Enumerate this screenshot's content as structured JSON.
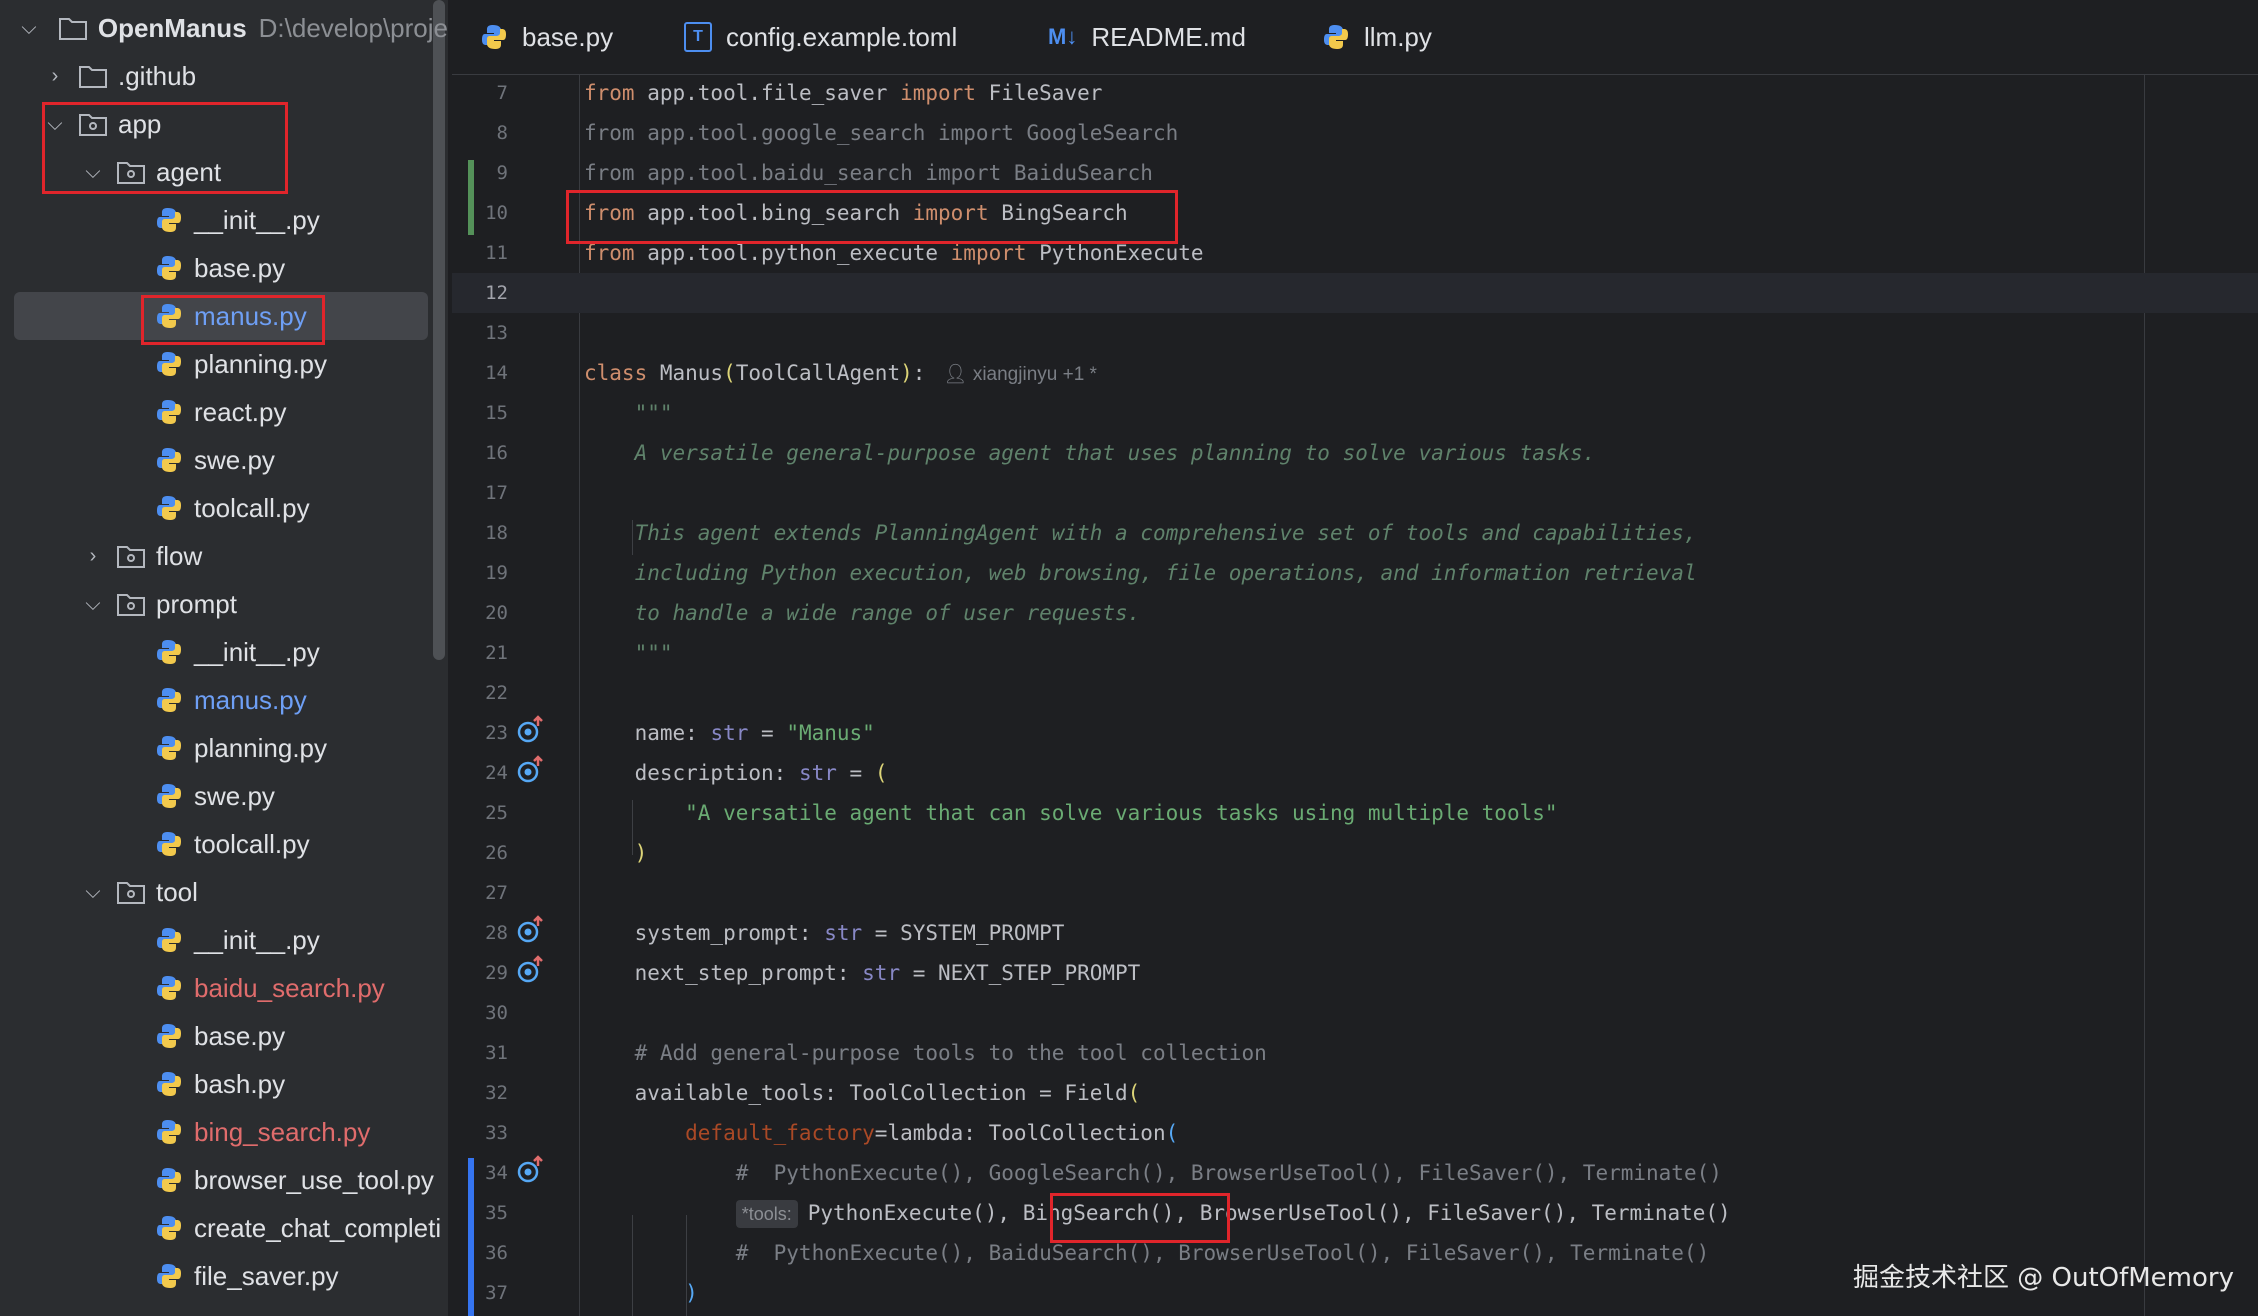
{
  "project": {
    "name": "OpenManus",
    "path": "D:\\develop\\proje"
  },
  "tree": [
    {
      "label": ".github",
      "type": "folder",
      "expanded": false,
      "depth": 1
    },
    {
      "label": "app",
      "type": "package",
      "expanded": true,
      "depth": 1
    },
    {
      "label": "agent",
      "type": "package",
      "expanded": true,
      "depth": 2
    },
    {
      "label": "__init__.py",
      "type": "python",
      "depth": 3
    },
    {
      "label": "base.py",
      "type": "python",
      "depth": 3
    },
    {
      "label": "manus.py",
      "type": "python",
      "depth": 3,
      "state": "selected"
    },
    {
      "label": "planning.py",
      "type": "python",
      "depth": 3
    },
    {
      "label": "react.py",
      "type": "python",
      "depth": 3
    },
    {
      "label": "swe.py",
      "type": "python",
      "depth": 3
    },
    {
      "label": "toolcall.py",
      "type": "python",
      "depth": 3
    },
    {
      "label": "flow",
      "type": "package",
      "expanded": false,
      "depth": 2
    },
    {
      "label": "prompt",
      "type": "package",
      "expanded": true,
      "depth": 2
    },
    {
      "label": "__init__.py",
      "type": "python",
      "depth": 3
    },
    {
      "label": "manus.py",
      "type": "python",
      "depth": 3,
      "state": "modified"
    },
    {
      "label": "planning.py",
      "type": "python",
      "depth": 3
    },
    {
      "label": "swe.py",
      "type": "python",
      "depth": 3
    },
    {
      "label": "toolcall.py",
      "type": "python",
      "depth": 3
    },
    {
      "label": "tool",
      "type": "package",
      "expanded": true,
      "depth": 2
    },
    {
      "label": "__init__.py",
      "type": "python",
      "depth": 3
    },
    {
      "label": "baidu_search.py",
      "type": "python",
      "depth": 3,
      "state": "new"
    },
    {
      "label": "base.py",
      "type": "python",
      "depth": 3
    },
    {
      "label": "bash.py",
      "type": "python",
      "depth": 3
    },
    {
      "label": "bing_search.py",
      "type": "python",
      "depth": 3,
      "state": "new"
    },
    {
      "label": "browser_use_tool.py",
      "type": "python",
      "depth": 3
    },
    {
      "label": "create_chat_completi",
      "type": "python",
      "depth": 3
    },
    {
      "label": "file_saver.py",
      "type": "python",
      "depth": 3
    }
  ],
  "tabs": [
    {
      "label": "base.py",
      "icon": "python-icon"
    },
    {
      "label": "config.example.toml",
      "icon": "toml-icon",
      "icon_text": "T"
    },
    {
      "label": "README.md",
      "icon": "markdown-icon",
      "icon_text": "M↓"
    },
    {
      "label": "llm.py",
      "icon": "python-icon"
    }
  ],
  "editor": {
    "lines": [
      {
        "n": "7",
        "tokens": [
          [
            "kw",
            "from"
          ],
          [
            "",
            "  app.tool.file_saver "
          ],
          [
            "kw",
            "import"
          ],
          [
            "",
            " FileSaver"
          ]
        ]
      },
      {
        "n": "8",
        "tokens": [
          [
            "cm",
            "from app.tool.google_search import GoogleSearch"
          ]
        ]
      },
      {
        "n": "9",
        "tokens": [
          [
            "cm",
            "from app.tool.baidu_search import BaiduSearch"
          ]
        ]
      },
      {
        "n": "10",
        "tokens": [
          [
            "kw",
            "from"
          ],
          [
            "",
            " app.tool.bing_search "
          ],
          [
            "kw",
            "import"
          ],
          [
            "",
            " BingSearch"
          ]
        ]
      },
      {
        "n": "11",
        "tokens": [
          [
            "kw",
            "from"
          ],
          [
            "",
            " app.tool.python_execute "
          ],
          [
            "kw",
            "import"
          ],
          [
            "",
            " PythonExecute"
          ]
        ]
      },
      {
        "n": "12",
        "tokens": []
      },
      {
        "n": "13",
        "tokens": []
      },
      {
        "n": "14",
        "tokens": [
          [
            "kw",
            "class"
          ],
          [
            "",
            " Manus"
          ],
          [
            "paren",
            "("
          ],
          [
            "",
            "ToolCallAgent"
          ],
          [
            "paren",
            ")"
          ],
          [
            "",
            ":"
          ]
        ]
      },
      {
        "n": "15",
        "tokens": [
          [
            "doc",
            "    \"\"\""
          ]
        ]
      },
      {
        "n": "16",
        "tokens": [
          [
            "doc",
            "    A versatile general-purpose agent that uses planning to solve various tasks."
          ]
        ]
      },
      {
        "n": "17",
        "tokens": []
      },
      {
        "n": "18",
        "tokens": [
          [
            "doc",
            "    This agent extends PlanningAgent with a comprehensive set of tools and capabilities,"
          ]
        ]
      },
      {
        "n": "19",
        "tokens": [
          [
            "doc",
            "    including Python execution, web browsing, file operations, and information retrieval"
          ]
        ]
      },
      {
        "n": "20",
        "tokens": [
          [
            "doc",
            "    to handle a wide range of user requests."
          ]
        ]
      },
      {
        "n": "21",
        "tokens": [
          [
            "doc",
            "    \"\"\""
          ]
        ]
      },
      {
        "n": "22",
        "tokens": []
      },
      {
        "n": "23",
        "tokens": [
          [
            "",
            "    name: "
          ],
          [
            "builtin",
            "str"
          ],
          [
            "",
            " = "
          ],
          [
            "str",
            "\"Manus\""
          ]
        ]
      },
      {
        "n": "24",
        "tokens": [
          [
            "",
            "    description: "
          ],
          [
            "builtin",
            "str"
          ],
          [
            "",
            " = "
          ],
          [
            "paren",
            "("
          ]
        ]
      },
      {
        "n": "25",
        "tokens": [
          [
            "str",
            "        \"A versatile agent that can solve various tasks using multiple tools\""
          ]
        ]
      },
      {
        "n": "26",
        "tokens": [
          [
            "paren",
            "    )"
          ]
        ]
      },
      {
        "n": "27",
        "tokens": []
      },
      {
        "n": "28",
        "tokens": [
          [
            "",
            "    system_prompt: "
          ],
          [
            "builtin",
            "str"
          ],
          [
            "",
            " = SYSTEM_PROMPT"
          ]
        ]
      },
      {
        "n": "29",
        "tokens": [
          [
            "",
            "    next_step_prompt: "
          ],
          [
            "builtin",
            "str"
          ],
          [
            "",
            " = NEXT_STEP_PROMPT"
          ]
        ]
      },
      {
        "n": "30",
        "tokens": []
      },
      {
        "n": "31",
        "tokens": [
          [
            "cm",
            "    # Add general-purpose tools to the tool collection"
          ]
        ]
      },
      {
        "n": "32",
        "tokens": [
          [
            "",
            "    available_tools: ToolCollection = Field"
          ],
          [
            "paren",
            "("
          ]
        ]
      },
      {
        "n": "33",
        "tokens": [
          [
            "param",
            "        default_factory"
          ],
          [
            "",
            "=lambda: ToolCollection"
          ],
          [
            "paren-b",
            "("
          ]
        ]
      },
      {
        "n": "34",
        "tokens": [
          [
            "cm",
            "            #  PythonExecute(), GoogleSearch(), BrowserUseTool(), FileSaver(), Terminate()"
          ]
        ]
      },
      {
        "n": "35",
        "tokens": []
      },
      {
        "n": "36",
        "tokens": [
          [
            "cm",
            "            #  PythonExecute(), BaiduSearch(), BrowserUseTool(), FileSaver(), Terminate()"
          ]
        ]
      },
      {
        "n": "37",
        "tokens": [
          [
            "paren-b",
            "        )"
          ]
        ]
      }
    ],
    "line35": {
      "hint": "*tools:",
      "before": "PythonExecute(), ",
      "highlight": "BingSearch()",
      "after": ", BrowserUseTool(), FileSaver(), Terminate()"
    },
    "author_hint": "xiangjinyu +1 *",
    "current_line": "12"
  },
  "watermark": "掘金技术社区 @ OutOfMemory"
}
